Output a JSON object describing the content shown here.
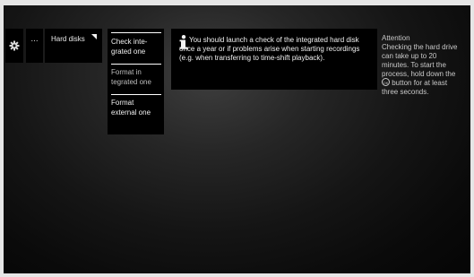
{
  "topbar": {
    "more_label": "...",
    "section_label": "Hard disks"
  },
  "menu": {
    "items": [
      {
        "line1": "Check inte-",
        "line2": "grated one"
      },
      {
        "line1": "Format in",
        "line2": "tegrated one"
      },
      {
        "line1": "Format",
        "line2": "external one"
      }
    ]
  },
  "info": {
    "icon": "info-icon",
    "text": "You should launch a check of the integrated hard disk once a year or if problems arise when starting recordings (e.g. when transferring to time-shift playback)."
  },
  "note": {
    "heading": "Attention",
    "body_before": "Checking the hard drive can take up to 20 minutes. To start the process, hold down the",
    "button_symbol": "OK",
    "body_after": "button for at least three seconds."
  }
}
